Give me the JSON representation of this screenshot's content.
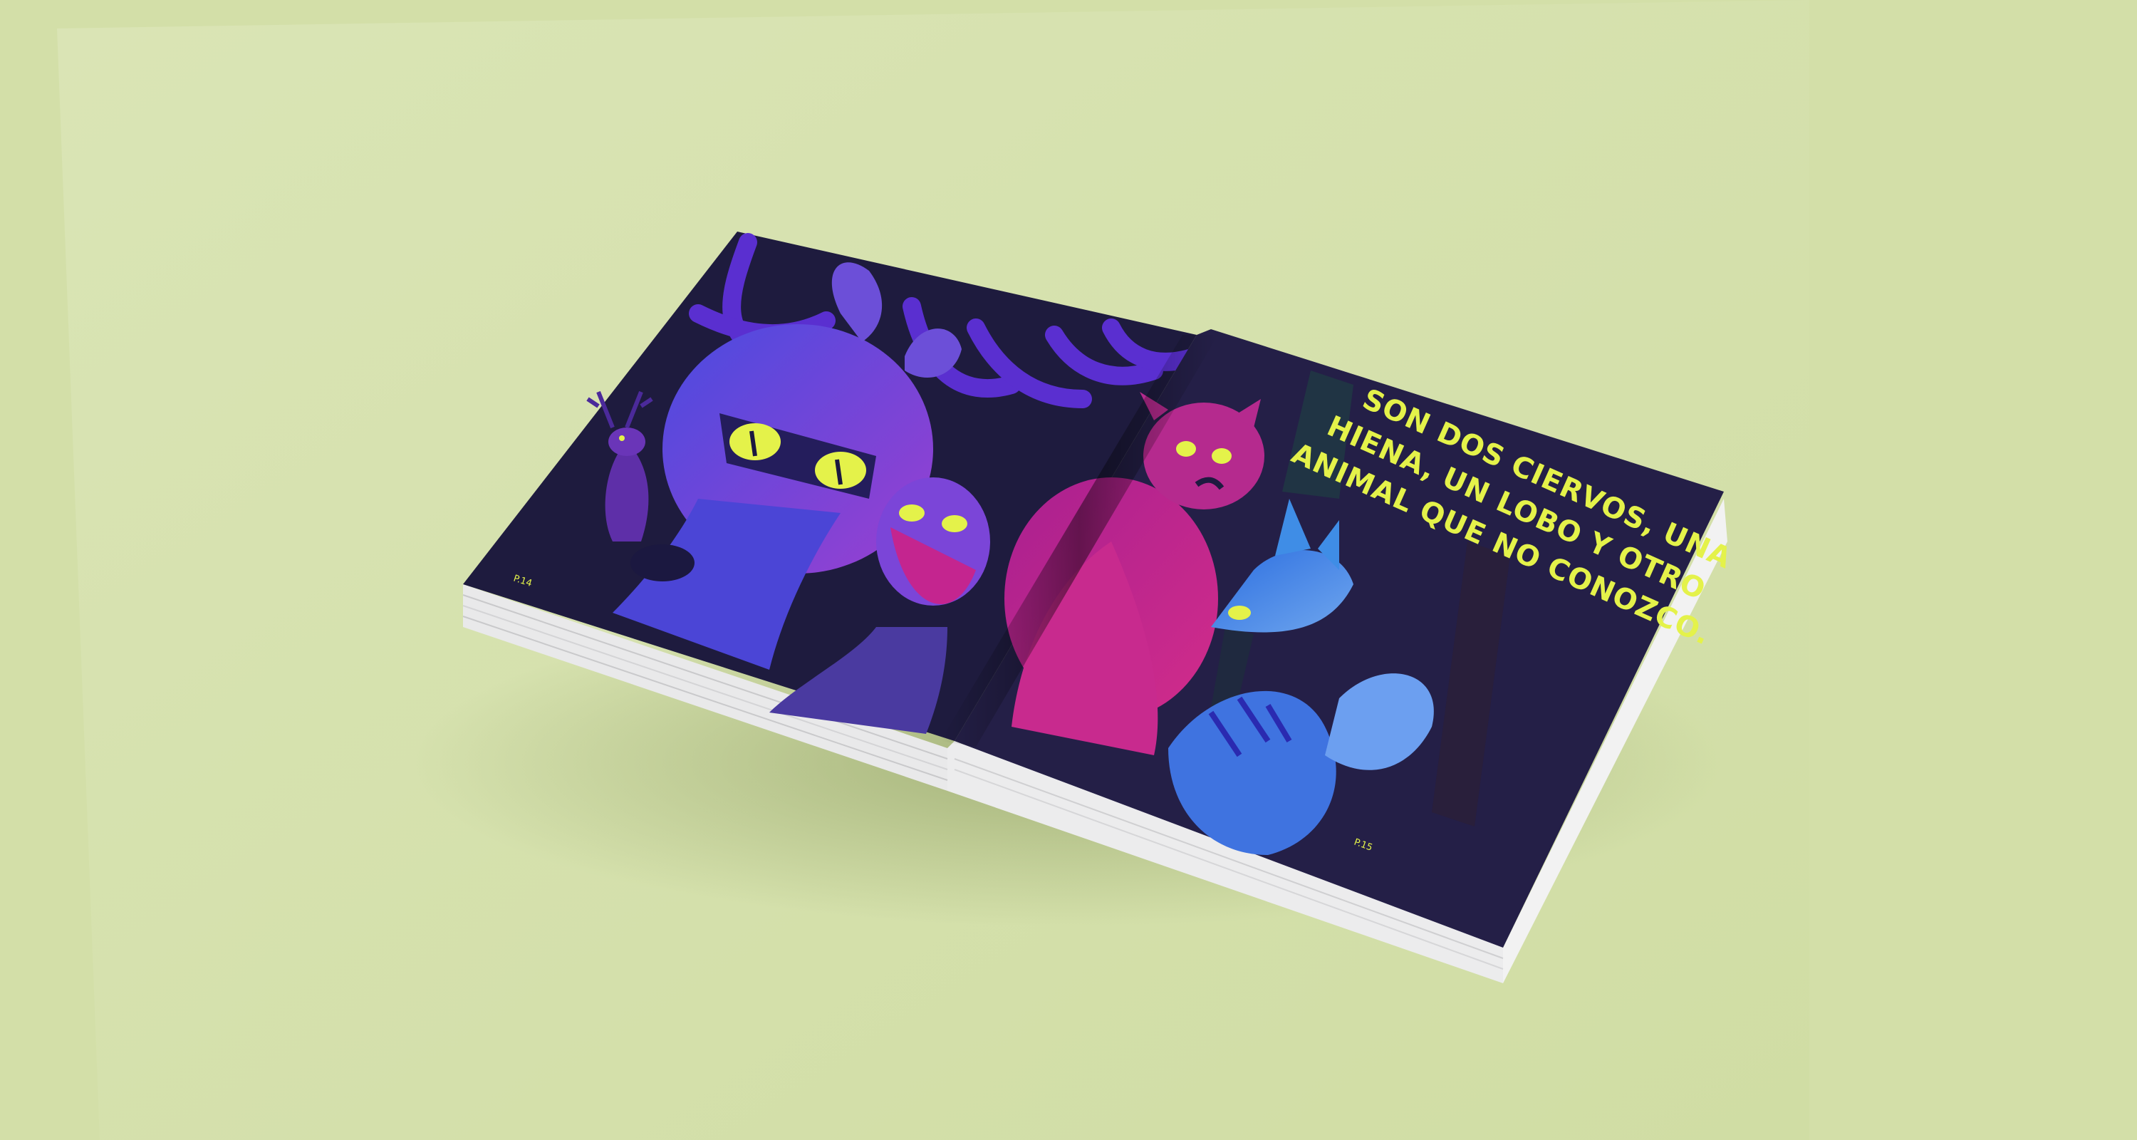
{
  "scene": {
    "description_colors": {
      "background": "#d3dfa8",
      "background_panel": "#dbe5b8",
      "page_dark": "#231f45",
      "accent_text": "#e4f24a",
      "deer_purple": "#6a3fd8",
      "hyena_pink": "#c4258f",
      "wolf_blue": "#3f8de6"
    }
  },
  "book": {
    "text_lines": [
      "SON DOS CIERVOS, UNA",
      "HIENA, UN LOBO Y OTRO",
      "ANIMAL QUE NO CONOZCO."
    ],
    "left_page_number": "P.14",
    "right_page_number": "P.15"
  }
}
